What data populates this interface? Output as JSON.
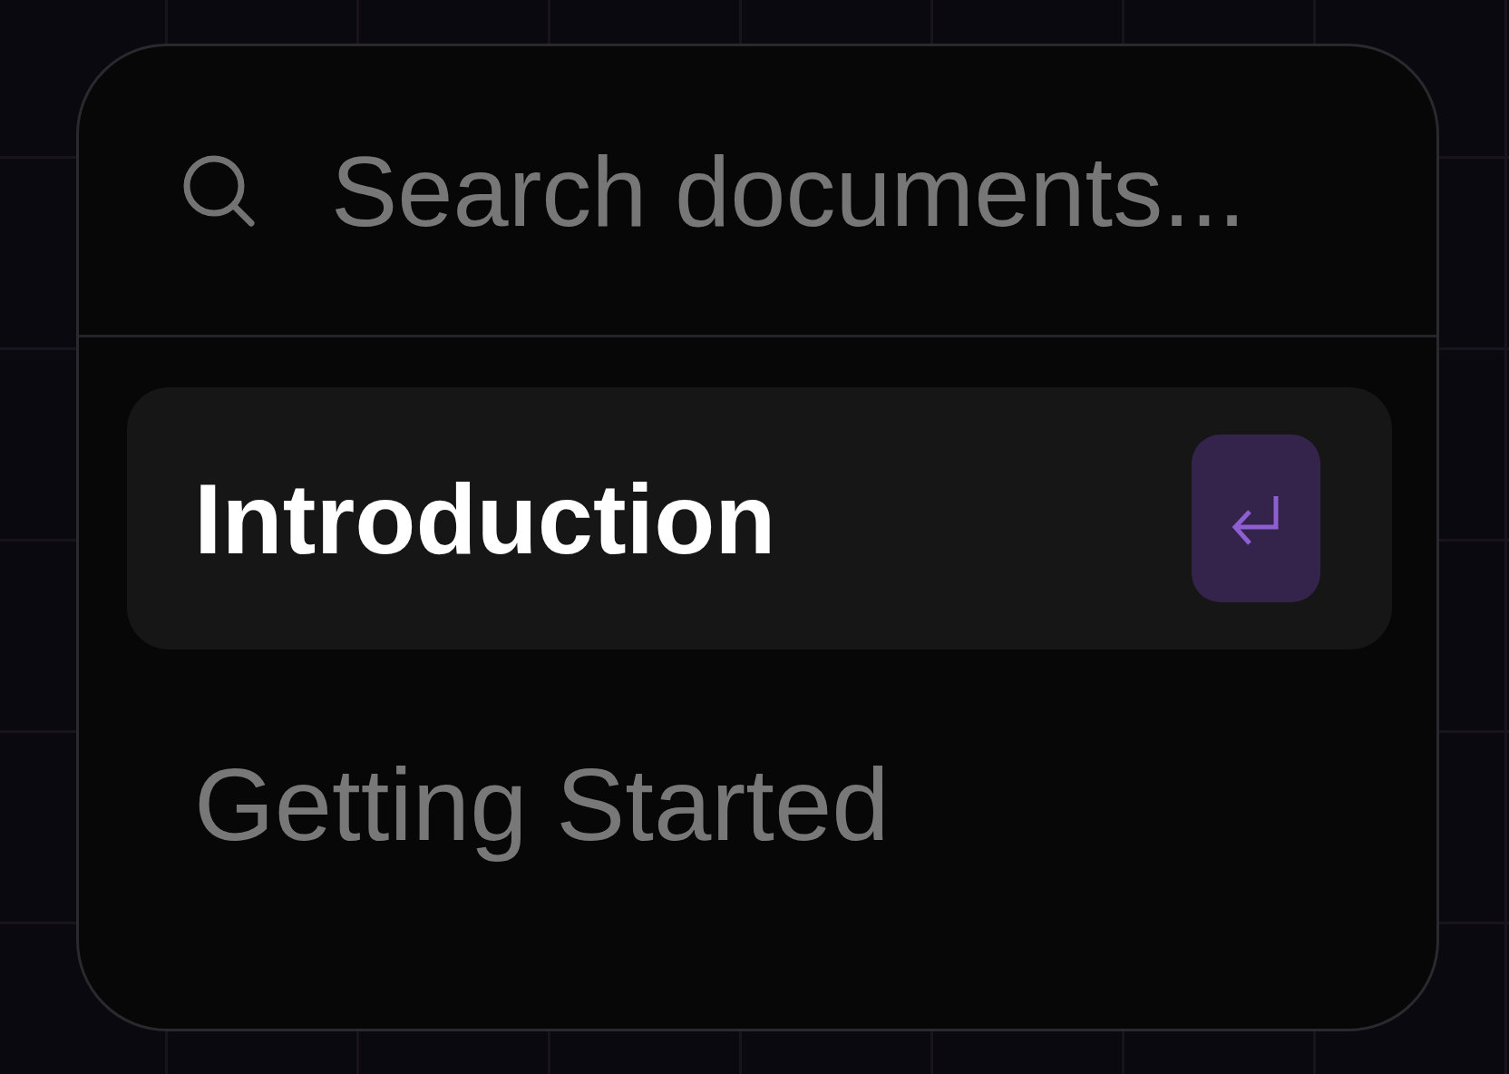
{
  "search": {
    "placeholder": "Search documents..."
  },
  "results": [
    {
      "title": "Introduction",
      "selected": true
    },
    {
      "title": "Getting Started",
      "selected": false
    }
  ]
}
